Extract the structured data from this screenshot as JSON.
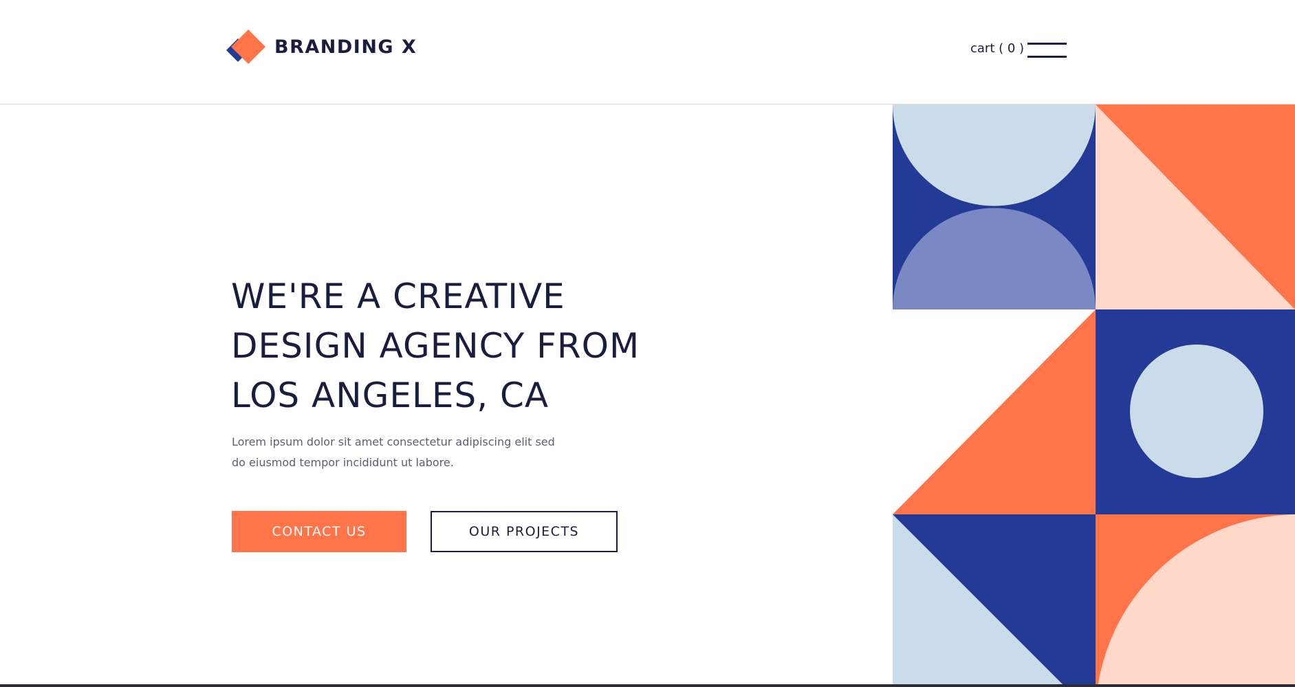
{
  "header": {
    "brand": {
      "name": "BRANDING X",
      "icon": "diamond-logo-icon"
    },
    "cart_label": "cart ( 0 )",
    "menu_icon": "hamburger-menu-icon"
  },
  "hero": {
    "title_lines": [
      "WE'RE A CREATIVE",
      "DESIGN AGENCY FROM",
      "LOS ANGELES, CA"
    ],
    "description_lines": [
      "Lorem ipsum dolor sit amet consectetur adipiscing elit sed",
      "do eiusmod tempor incididunt ut labore."
    ],
    "primary_button": "CONTACT US",
    "secondary_button": "OUR PROJECTS"
  },
  "colors": {
    "navy_text": "#1b1d3f",
    "orange": "#ff7448",
    "royal_blue": "#233a96",
    "periwinkle": "#7a88c3",
    "light_blue": "#cadbe9",
    "peach": "#ffd8ca"
  }
}
